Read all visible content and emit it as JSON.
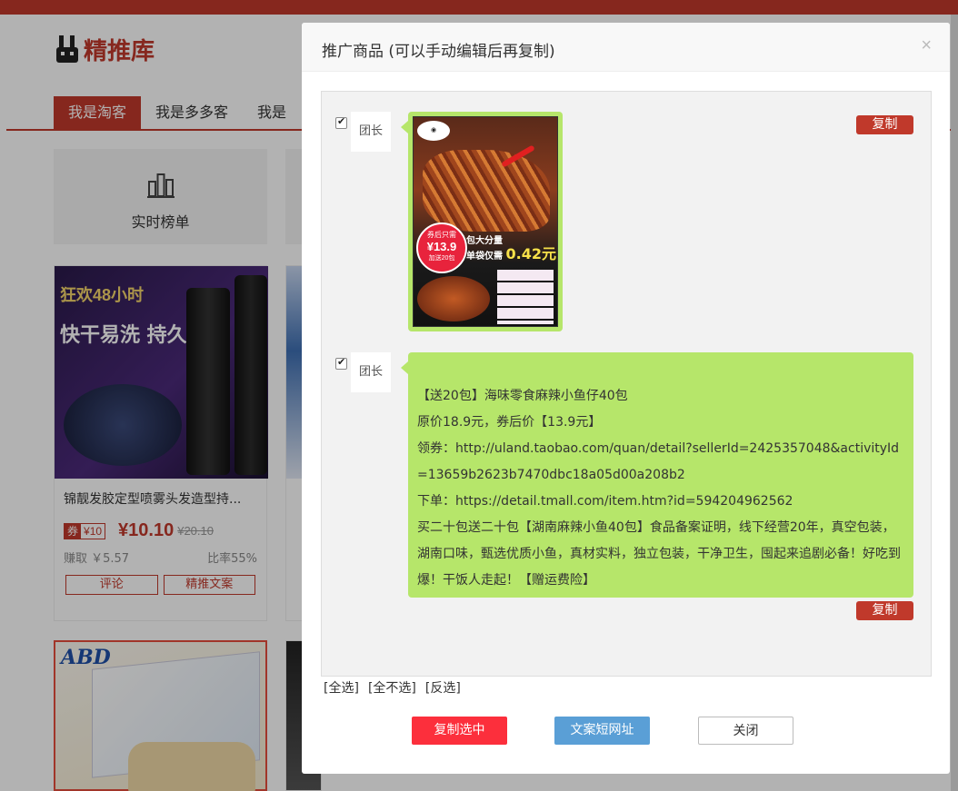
{
  "background": {
    "logo_text": "精推库",
    "tabs": [
      "我是淘客",
      "我是多多客",
      "我是"
    ],
    "rank_label": "实时榜单",
    "product": {
      "image_text_1": "狂欢48小时",
      "image_text_2": "快干易洗 持久定型",
      "title": "锦靓发胶定型喷雾头发造型持...",
      "coupon_label": "券",
      "coupon_value": "¥10",
      "price": "¥10.10",
      "original_price": "¥20.10",
      "earn": "赚取 ￥5.57",
      "rate": "比率55%",
      "btn_comment": "评论",
      "btn_copy": "精推文案"
    },
    "product3_brand": "ABD"
  },
  "modal": {
    "title": "推广商品 (可以手动编辑后再复制)",
    "close": "×",
    "message1": {
      "avatar_label": "团长",
      "copy_label": "复制",
      "image": {
        "badge_top": "券后只需",
        "badge_price": "¥13.9",
        "badge_bottom": "加送20包",
        "slogan_line1": "包大分量",
        "slogan_line2": "单袋仅需",
        "slogan_price": "0.42元"
      }
    },
    "message2": {
      "avatar_label": "团长",
      "copy_label": "复制",
      "lines": [
        "【送20包】海味零食麻辣小鱼仔40包",
        "原价18.9元，券后价【13.9元】",
        "领券：http://uland.taobao.com/quan/detail?sellerId=2425357048&activityId=13659b2623b7470dbc18a05d00a208b2",
        "下单：https://detail.tmall.com/item.htm?id=594204962562",
        "买二十包送二十包【湖南麻辣小鱼40包】食品备案证明，线下经营20年，真空包装，湖南口味，甄选优质小鱼，真材实料，独立包装，干净卫生，囤起来追剧必备！好吃到爆！干饭人走起！【赠运费险】"
      ]
    },
    "select_all": "[全选]",
    "select_none": "[全不选]",
    "select_invert": "[反选]",
    "btn_copy_selected": "复制选中",
    "btn_short_url": "文案短网址",
    "btn_close": "关闭"
  },
  "colors": {
    "brand_red": "#c0392b",
    "bubble_green": "#b6e66a",
    "btn_red": "#fc2f3c",
    "btn_blue": "#5a9fd6"
  }
}
